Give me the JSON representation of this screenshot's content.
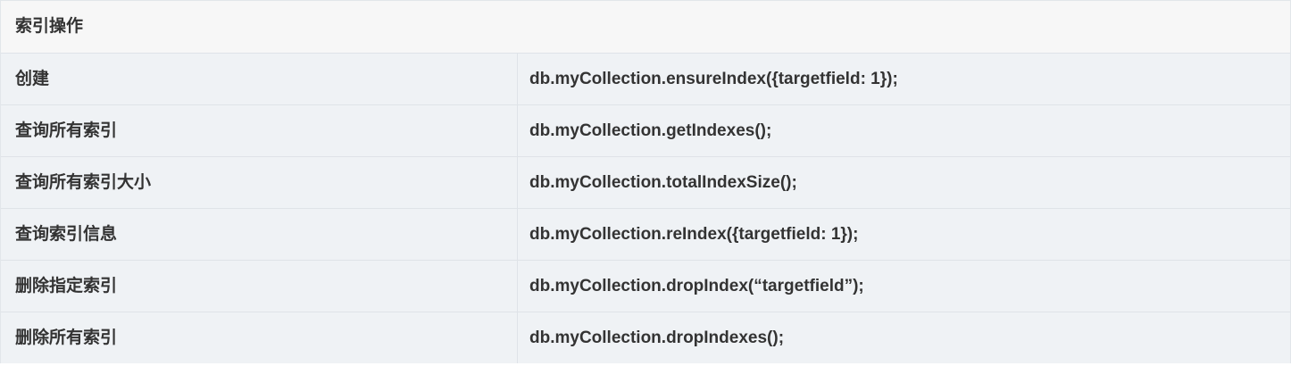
{
  "table": {
    "header": "索引操作",
    "rows": [
      {
        "op": "创建",
        "cmd": "db.myCollection.ensureIndex({targetfield: 1});"
      },
      {
        "op": "查询所有索引",
        "cmd": "db.myCollection.getIndexes();"
      },
      {
        "op": "查询所有索引大小",
        "cmd": "db.myCollection.totalIndexSize();"
      },
      {
        "op": "查询索引信息",
        "cmd": "db.myCollection.reIndex({targetfield: 1});"
      },
      {
        "op": "删除指定索引",
        "cmd": "db.myCollection.dropIndex(“targetfield”);"
      },
      {
        "op": "删除所有索引",
        "cmd": "db.myCollection.dropIndexes();"
      }
    ]
  }
}
